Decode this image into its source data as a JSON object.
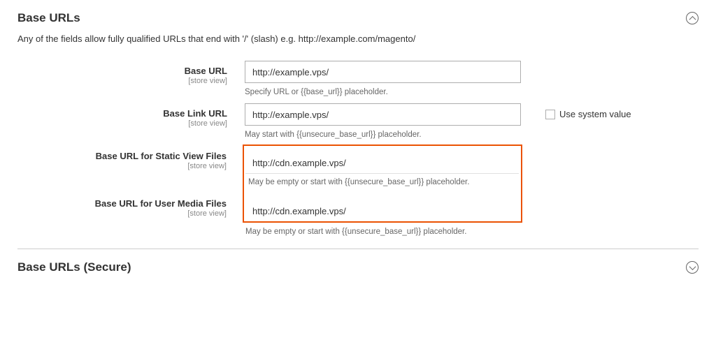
{
  "sections": {
    "base_urls": {
      "title": "Base URLs",
      "desc": "Any of the fields allow fully qualified URLs that end with '/' (slash) e.g. http://example.com/magento/"
    },
    "base_urls_secure": {
      "title": "Base URLs (Secure)"
    }
  },
  "scope_label": "[store view]",
  "fields": {
    "base_url": {
      "label": "Base URL",
      "value": "http://example.vps/",
      "helper": "Specify URL or {{base_url}} placeholder."
    },
    "base_link_url": {
      "label": "Base Link URL",
      "value": "http://example.vps/",
      "helper": "May start with {{unsecure_base_url}} placeholder.",
      "use_system_label": "Use system value"
    },
    "base_static_url": {
      "label": "Base URL for Static View Files",
      "value": "http://cdn.example.vps/",
      "helper": "May be empty or start with {{unsecure_base_url}} placeholder."
    },
    "base_media_url": {
      "label": "Base URL for User Media Files",
      "value": "http://cdn.example.vps/",
      "helper": "May be empty or start with {{unsecure_base_url}} placeholder."
    }
  }
}
